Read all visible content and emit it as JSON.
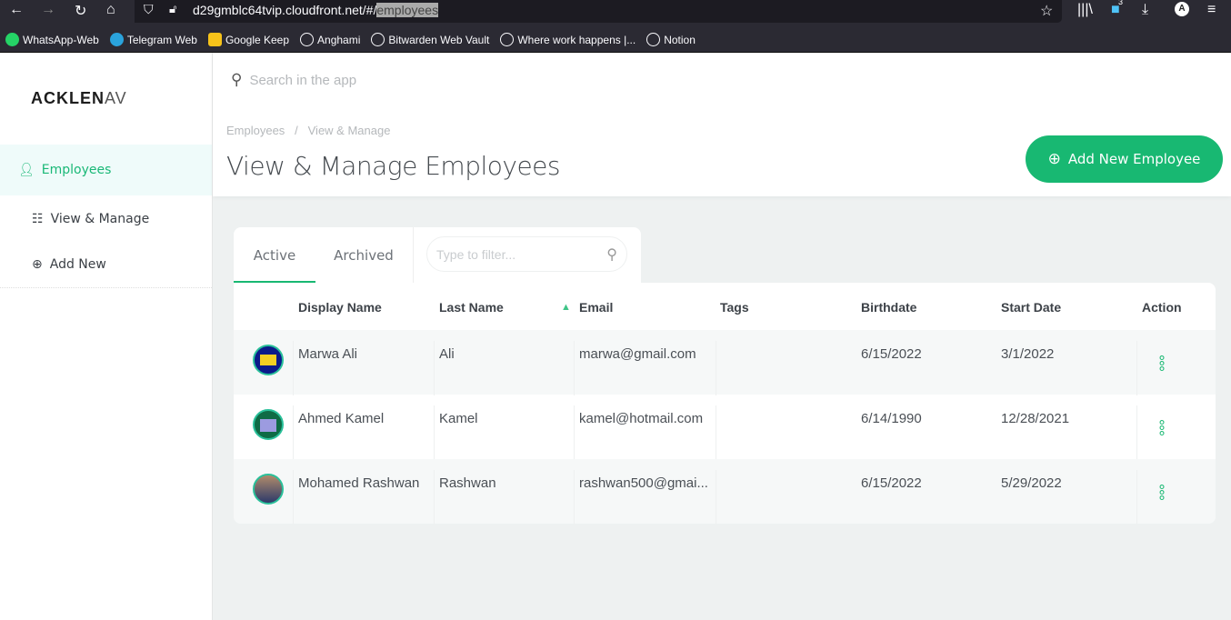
{
  "browser": {
    "url_prefix": "d29gmblc64tvip.cloudfront.net/#/",
    "url_selected": "employees",
    "notif_count": "3",
    "profile": "A",
    "bookmarks": [
      "WhatsApp-Web",
      "Telegram Web",
      "Google Keep",
      "Anghami",
      "Bitwarden Web Vault",
      "Where work happens |...",
      "Notion"
    ]
  },
  "logo": {
    "bold": "ACKLEN",
    "light": "AV"
  },
  "sidebar": {
    "items": [
      {
        "label": "Employees"
      },
      {
        "label": "View & Manage"
      },
      {
        "label": "Add New"
      }
    ]
  },
  "header": {
    "search_placeholder": "Search in the app",
    "breadcrumb": [
      "Employees",
      "View & Manage"
    ],
    "breadcrumb_sep": "/",
    "title": "View & Manage Employees",
    "add_button": "Add New Employee"
  },
  "tabs": [
    {
      "label": "Active"
    },
    {
      "label": "Archived"
    }
  ],
  "filter_placeholder": "Type to filter...",
  "table": {
    "columns": [
      "Display Name",
      "Last Name",
      "Email",
      "Tags",
      "Birthdate",
      "Start Date",
      "Action"
    ],
    "rows": [
      {
        "display": "Marwa Ali",
        "last": "Ali",
        "email": "marwa@gmail.com",
        "tags": "",
        "birth": "6/15/2022",
        "start": "3/1/2022"
      },
      {
        "display": "Ahmed Kamel",
        "last": "Kamel",
        "email": "kamel@hotmail.com",
        "tags": "",
        "birth": "6/14/1990",
        "start": "12/28/2021"
      },
      {
        "display": "Mohamed Rashwan",
        "last": "Rashwan",
        "email": "rashwan500@gmai...",
        "tags": "",
        "birth": "6/15/2022",
        "start": "5/29/2022"
      }
    ]
  },
  "colors": {
    "accent": "#18b872",
    "bg": "#eef1f1"
  }
}
